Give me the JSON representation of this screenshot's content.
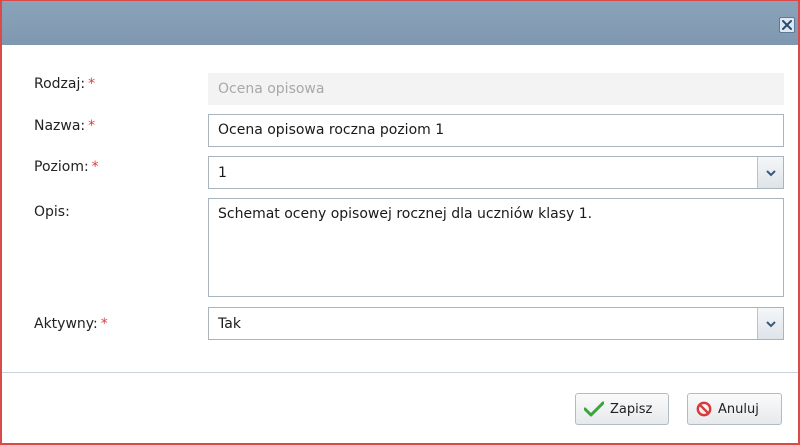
{
  "dialog": {
    "close_icon": "close-icon",
    "colors": {
      "titlebar": "#8aa3ba",
      "required": "#e03a3a",
      "border": "#d94a4a"
    }
  },
  "form": {
    "required_marker": "*",
    "rodzaj": {
      "label": "Rodzaj:",
      "value": "Ocena opisowa"
    },
    "nazwa": {
      "label": "Nazwa:",
      "value": "Ocena opisowa roczna poziom 1"
    },
    "poziom": {
      "label": "Poziom:",
      "value": "1"
    },
    "opis": {
      "label": "Opis:",
      "value": "Schemat oceny opisowej rocznej dla uczniów klasy 1."
    },
    "aktywny": {
      "label": "Aktywny:",
      "value": "Tak"
    }
  },
  "buttons": {
    "save": {
      "label": "Zapisz",
      "icon": "checkmark-icon"
    },
    "cancel": {
      "label": "Anuluj",
      "icon": "cancel-icon"
    }
  }
}
